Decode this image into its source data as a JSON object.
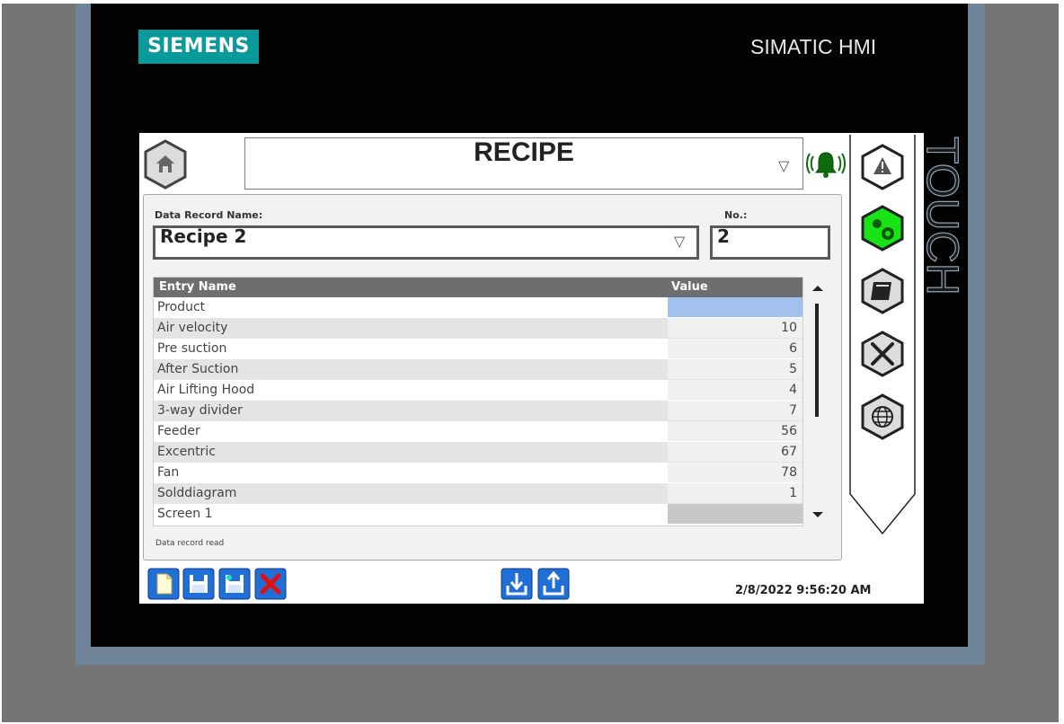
{
  "device": {
    "brand": "SIEMENS",
    "model": "SIMATIC HMI",
    "side_label": "TOUCH"
  },
  "header": {
    "title": "RECIPE",
    "home_icon": "home-icon",
    "alarm_icon": "alarm-bell-icon"
  },
  "recipe": {
    "data_record_label": "Data Record Name:",
    "data_record_value": "Recipe 2",
    "number_label": "No.:",
    "number_value": "2"
  },
  "table": {
    "columns": [
      "Entry Name",
      "Value"
    ],
    "rows": [
      {
        "name": "Product",
        "value": ""
      },
      {
        "name": "Air velocity",
        "value": "10"
      },
      {
        "name": "Pre suction",
        "value": "6"
      },
      {
        "name": "After Suction",
        "value": "5"
      },
      {
        "name": "Air Lifting Hood",
        "value": "4"
      },
      {
        "name": "3-way divider",
        "value": "7"
      },
      {
        "name": "Feeder",
        "value": "56"
      },
      {
        "name": "Excentric",
        "value": "67"
      },
      {
        "name": "Fan",
        "value": "78"
      },
      {
        "name": "Solddiagram",
        "value": "1"
      },
      {
        "name": "Screen 1",
        "value": ""
      }
    ]
  },
  "status_text": "Data record read",
  "toolbar": {
    "buttons": [
      "new-record-icon",
      "save-icon",
      "save-as-icon",
      "delete-icon",
      "import-icon",
      "export-icon"
    ]
  },
  "datetime": "2/8/2022 9:56:20 AM",
  "nav": {
    "items": [
      "alarm-icon",
      "settings-gear-icon",
      "manual-book-icon",
      "tools-icon",
      "language-globe-icon"
    ]
  },
  "colors": {
    "brand_teal": "#0b9a9a",
    "active_green": "#17e317",
    "selection_blue": "#a3c1ef",
    "header_gray": "#6e6e6e",
    "button_blue": "#1f6fd6"
  }
}
